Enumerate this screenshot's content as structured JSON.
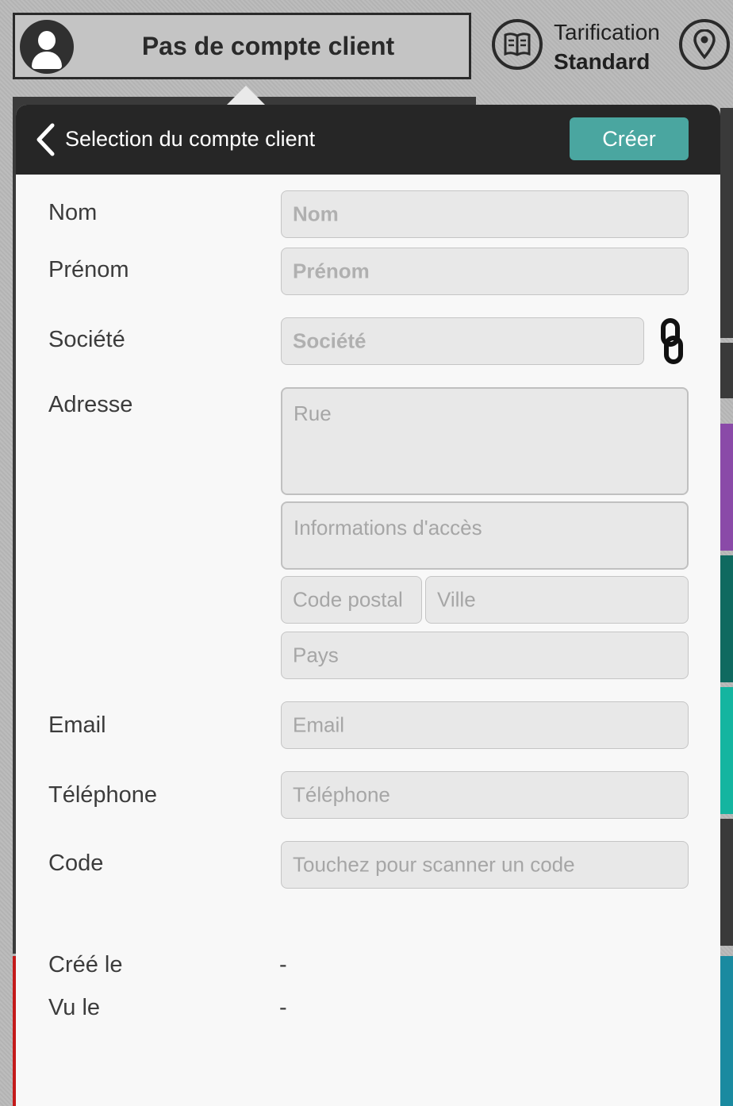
{
  "topbar": {
    "account_label": "Pas de compte client",
    "pricing_line1": "Tarification",
    "pricing_line2": "Standard",
    "icons": [
      "user-icon",
      "book-icon",
      "location-pin-icon"
    ]
  },
  "panel": {
    "title": "Selection du compte client",
    "create_label": "Créer",
    "accent_color": "#4aa6a0",
    "fields": {
      "nom": {
        "label": "Nom",
        "placeholder": "Nom"
      },
      "prenom": {
        "label": "Prénom",
        "placeholder": "Prénom"
      },
      "societe": {
        "label": "Société",
        "placeholder": "Société"
      },
      "adresse": {
        "label": "Adresse",
        "rue_placeholder": "Rue",
        "acces_placeholder": "Informations d'accès",
        "cp_placeholder": "Code postal",
        "ville_placeholder": "Ville",
        "pays_placeholder": "Pays"
      },
      "email": {
        "label": "Email",
        "placeholder": "Email"
      },
      "telephone": {
        "label": "Téléphone",
        "placeholder": "Téléphone"
      },
      "code": {
        "label": "Code",
        "placeholder": "Touchez pour scanner un code"
      }
    },
    "meta": {
      "created_label": "Créé le",
      "created_value": "-",
      "seen_label": "Vu le",
      "seen_value": "-"
    }
  }
}
